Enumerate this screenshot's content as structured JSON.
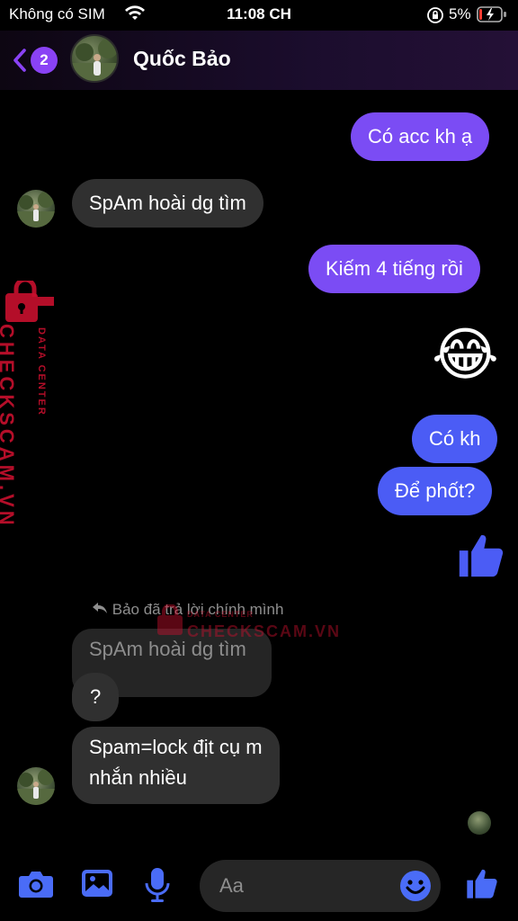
{
  "status_bar": {
    "carrier": "Không có SIM",
    "time": "11:08 CH",
    "battery_percent": "5%"
  },
  "header": {
    "back_badge": "2",
    "contact_name": "Quốc Bảo"
  },
  "messages": {
    "m1": "Có acc kh ạ",
    "m2": "SpAm hoài dg tìm",
    "m3": "Kiếm 4 tiếng rồi",
    "m4_emoji": "😂",
    "m5": "Có kh",
    "m6": "Để phốt?",
    "reply_note": "Bảo đã trả lời chính mình",
    "quoted": "SpAm hoài dg tìm",
    "m7": "?",
    "m8_line1": "Spam=lock địt cụ m",
    "m8_line2": "nhắn nhiều"
  },
  "watermark": {
    "brand": "CHECKSCAM.VN",
    "sub": "DATA CENTER"
  },
  "composer": {
    "placeholder": "Aa"
  },
  "colors": {
    "outgoing_purple": "#7b4cf4",
    "outgoing_blue": "#4b5cf5",
    "incoming_gray": "#303030",
    "accent": "#8a42f5",
    "toolbar_icon": "#4a6cf7",
    "watermark_red": "#c8102e"
  },
  "icons": [
    "wifi-icon",
    "lock-rotation-icon",
    "battery-charging-icon",
    "back-chevron-icon",
    "camera-icon",
    "gallery-icon",
    "microphone-icon",
    "emoji-icon",
    "thumbs-up-icon",
    "reply-icon"
  ]
}
